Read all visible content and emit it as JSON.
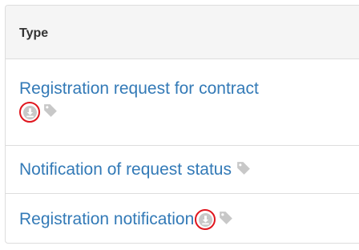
{
  "table": {
    "header": "Type",
    "rows": [
      {
        "label": "Registration request for contract",
        "download_icon": "download-icon",
        "tag_icon": "tag-icon"
      },
      {
        "label": "Notification of request status",
        "tag_icon": "tag-icon"
      },
      {
        "label": "Registration notification",
        "download_icon": "download-icon",
        "tag_icon": "tag-icon"
      }
    ]
  },
  "colors": {
    "link": "#337ab7",
    "icon_gray": "#c8c8c8",
    "highlight_circle": "#e0161e",
    "header_bg": "#f5f5f5",
    "border": "#dddddd"
  }
}
